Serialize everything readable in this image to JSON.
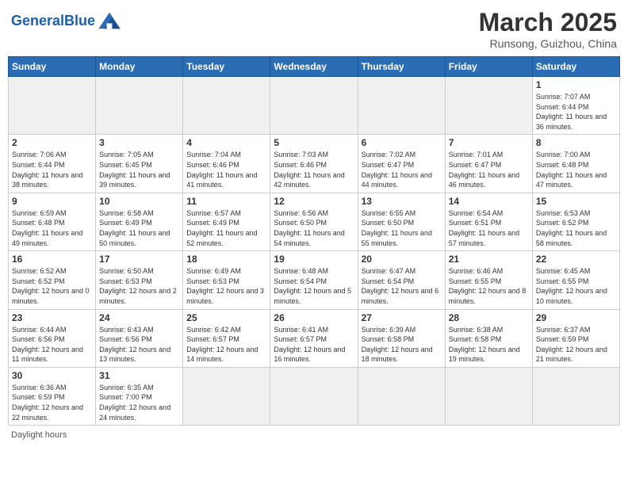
{
  "header": {
    "logo_general": "General",
    "logo_blue": "Blue",
    "month_title": "March 2025",
    "location": "Runsong, Guizhou, China"
  },
  "weekdays": [
    "Sunday",
    "Monday",
    "Tuesday",
    "Wednesday",
    "Thursday",
    "Friday",
    "Saturday"
  ],
  "footer": "Daylight hours",
  "weeks": [
    [
      {
        "day": "",
        "info": ""
      },
      {
        "day": "",
        "info": ""
      },
      {
        "day": "",
        "info": ""
      },
      {
        "day": "",
        "info": ""
      },
      {
        "day": "",
        "info": ""
      },
      {
        "day": "",
        "info": ""
      },
      {
        "day": "1",
        "info": "Sunrise: 7:07 AM\nSunset: 6:44 PM\nDaylight: 11 hours and 36 minutes."
      }
    ],
    [
      {
        "day": "2",
        "info": "Sunrise: 7:06 AM\nSunset: 6:44 PM\nDaylight: 11 hours and 38 minutes."
      },
      {
        "day": "3",
        "info": "Sunrise: 7:05 AM\nSunset: 6:45 PM\nDaylight: 11 hours and 39 minutes."
      },
      {
        "day": "4",
        "info": "Sunrise: 7:04 AM\nSunset: 6:46 PM\nDaylight: 11 hours and 41 minutes."
      },
      {
        "day": "5",
        "info": "Sunrise: 7:03 AM\nSunset: 6:46 PM\nDaylight: 11 hours and 42 minutes."
      },
      {
        "day": "6",
        "info": "Sunrise: 7:02 AM\nSunset: 6:47 PM\nDaylight: 11 hours and 44 minutes."
      },
      {
        "day": "7",
        "info": "Sunrise: 7:01 AM\nSunset: 6:47 PM\nDaylight: 11 hours and 46 minutes."
      },
      {
        "day": "8",
        "info": "Sunrise: 7:00 AM\nSunset: 6:48 PM\nDaylight: 11 hours and 47 minutes."
      }
    ],
    [
      {
        "day": "9",
        "info": "Sunrise: 6:59 AM\nSunset: 6:48 PM\nDaylight: 11 hours and 49 minutes."
      },
      {
        "day": "10",
        "info": "Sunrise: 6:58 AM\nSunset: 6:49 PM\nDaylight: 11 hours and 50 minutes."
      },
      {
        "day": "11",
        "info": "Sunrise: 6:57 AM\nSunset: 6:49 PM\nDaylight: 11 hours and 52 minutes."
      },
      {
        "day": "12",
        "info": "Sunrise: 6:56 AM\nSunset: 6:50 PM\nDaylight: 11 hours and 54 minutes."
      },
      {
        "day": "13",
        "info": "Sunrise: 6:55 AM\nSunset: 6:50 PM\nDaylight: 11 hours and 55 minutes."
      },
      {
        "day": "14",
        "info": "Sunrise: 6:54 AM\nSunset: 6:51 PM\nDaylight: 11 hours and 57 minutes."
      },
      {
        "day": "15",
        "info": "Sunrise: 6:53 AM\nSunset: 6:52 PM\nDaylight: 11 hours and 58 minutes."
      }
    ],
    [
      {
        "day": "16",
        "info": "Sunrise: 6:52 AM\nSunset: 6:52 PM\nDaylight: 12 hours and 0 minutes."
      },
      {
        "day": "17",
        "info": "Sunrise: 6:50 AM\nSunset: 6:53 PM\nDaylight: 12 hours and 2 minutes."
      },
      {
        "day": "18",
        "info": "Sunrise: 6:49 AM\nSunset: 6:53 PM\nDaylight: 12 hours and 3 minutes."
      },
      {
        "day": "19",
        "info": "Sunrise: 6:48 AM\nSunset: 6:54 PM\nDaylight: 12 hours and 5 minutes."
      },
      {
        "day": "20",
        "info": "Sunrise: 6:47 AM\nSunset: 6:54 PM\nDaylight: 12 hours and 6 minutes."
      },
      {
        "day": "21",
        "info": "Sunrise: 6:46 AM\nSunset: 6:55 PM\nDaylight: 12 hours and 8 minutes."
      },
      {
        "day": "22",
        "info": "Sunrise: 6:45 AM\nSunset: 6:55 PM\nDaylight: 12 hours and 10 minutes."
      }
    ],
    [
      {
        "day": "23",
        "info": "Sunrise: 6:44 AM\nSunset: 6:56 PM\nDaylight: 12 hours and 11 minutes."
      },
      {
        "day": "24",
        "info": "Sunrise: 6:43 AM\nSunset: 6:56 PM\nDaylight: 12 hours and 13 minutes."
      },
      {
        "day": "25",
        "info": "Sunrise: 6:42 AM\nSunset: 6:57 PM\nDaylight: 12 hours and 14 minutes."
      },
      {
        "day": "26",
        "info": "Sunrise: 6:41 AM\nSunset: 6:57 PM\nDaylight: 12 hours and 16 minutes."
      },
      {
        "day": "27",
        "info": "Sunrise: 6:39 AM\nSunset: 6:58 PM\nDaylight: 12 hours and 18 minutes."
      },
      {
        "day": "28",
        "info": "Sunrise: 6:38 AM\nSunset: 6:58 PM\nDaylight: 12 hours and 19 minutes."
      },
      {
        "day": "29",
        "info": "Sunrise: 6:37 AM\nSunset: 6:59 PM\nDaylight: 12 hours and 21 minutes."
      }
    ],
    [
      {
        "day": "30",
        "info": "Sunrise: 6:36 AM\nSunset: 6:59 PM\nDaylight: 12 hours and 22 minutes."
      },
      {
        "day": "31",
        "info": "Sunrise: 6:35 AM\nSunset: 7:00 PM\nDaylight: 12 hours and 24 minutes."
      },
      {
        "day": "",
        "info": ""
      },
      {
        "day": "",
        "info": ""
      },
      {
        "day": "",
        "info": ""
      },
      {
        "day": "",
        "info": ""
      },
      {
        "day": "",
        "info": ""
      }
    ]
  ]
}
